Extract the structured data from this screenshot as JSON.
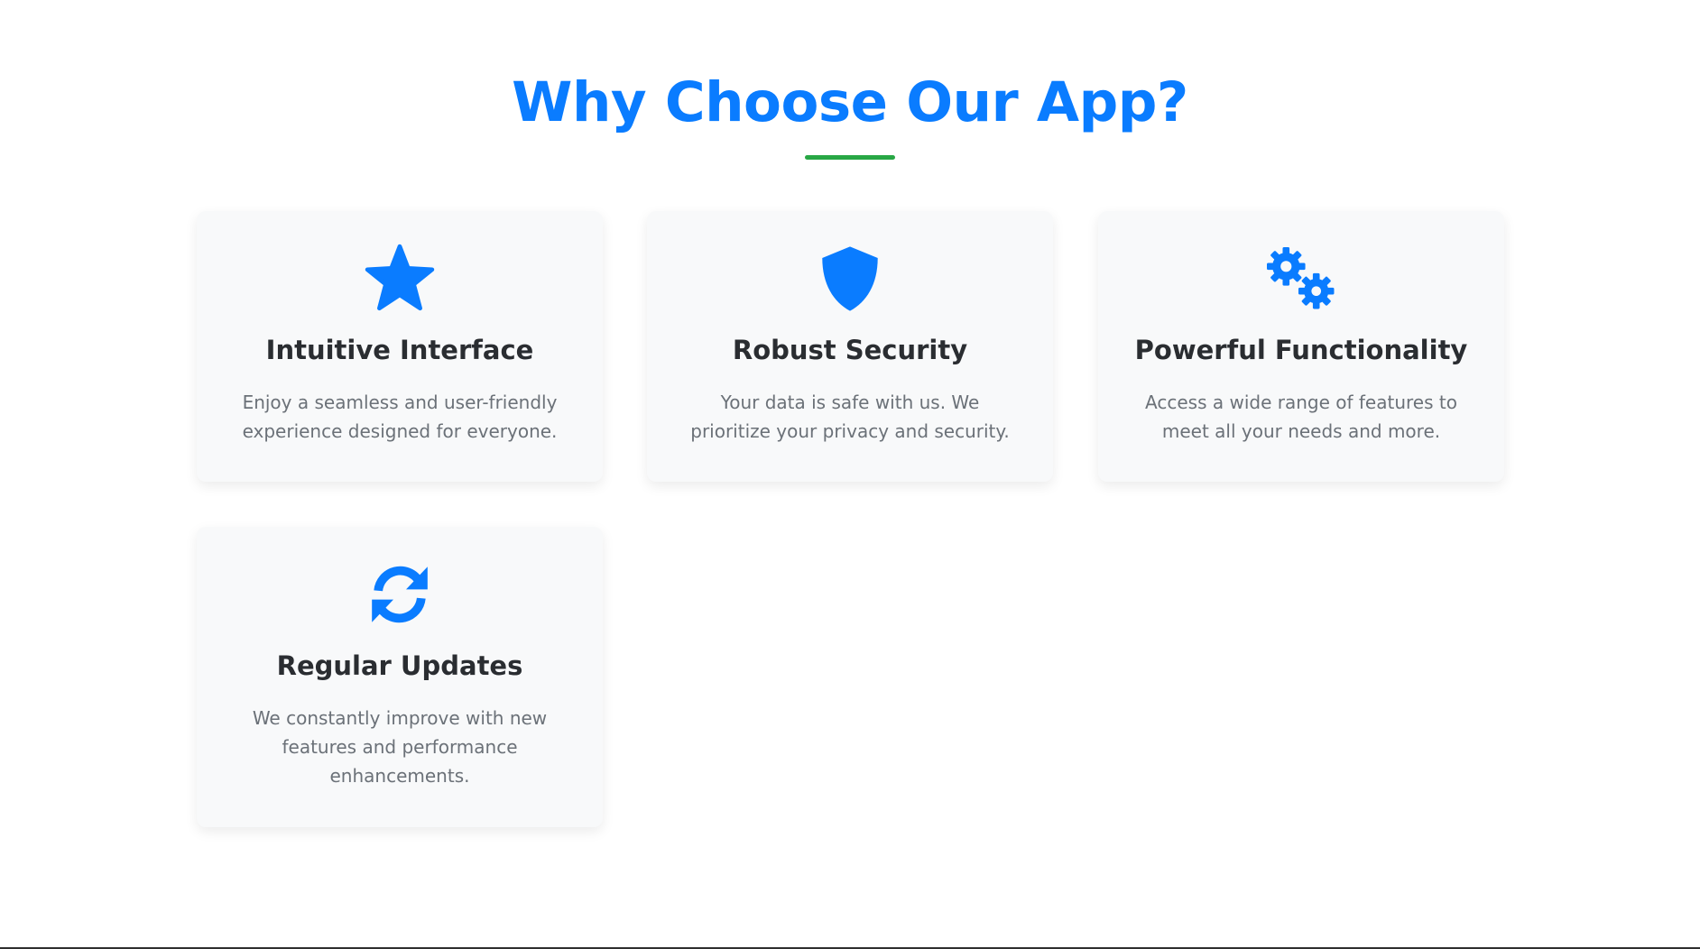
{
  "section": {
    "title": "Why Choose Our App?",
    "accent_color": "#0a7cff",
    "underline_color": "#28a745"
  },
  "features": [
    {
      "icon": "star-icon",
      "title": "Intuitive Interface",
      "description": "Enjoy a seamless and user-friendly experience designed for everyone."
    },
    {
      "icon": "shield-icon",
      "title": "Robust Security",
      "description": "Your data is safe with us. We prioritize your privacy and security."
    },
    {
      "icon": "gears-icon",
      "title": "Powerful Functionality",
      "description": "Access a wide range of features to meet all your needs and more."
    },
    {
      "icon": "refresh-icon",
      "title": "Regular Updates",
      "description": "We constantly improve with new features and performance enhancements."
    }
  ]
}
